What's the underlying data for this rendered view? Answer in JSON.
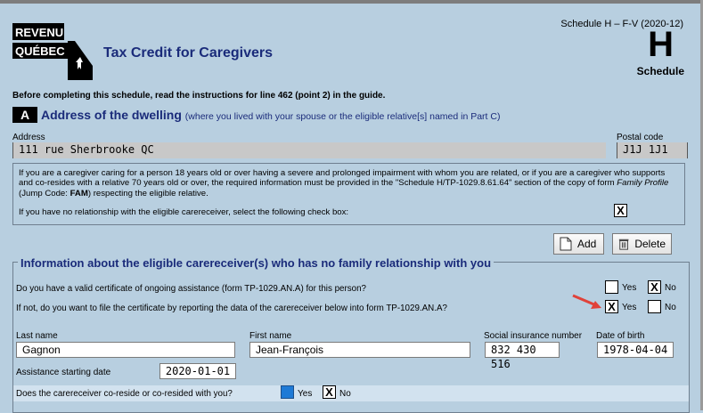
{
  "header": {
    "logo_line1": "REVENU",
    "logo_line2": "QUÉBEC",
    "title": "Tax Credit for Caregivers",
    "schedule_ref": "Schedule H – F-V (2020-12)",
    "schedule_letter": "H",
    "schedule_word": "Schedule"
  },
  "instructions": "Before completing this schedule, read the instructions for line 462 (point 2) in the guide.",
  "section_a": {
    "badge": "A",
    "title": "Address of the dwelling",
    "subtitle": "(where you lived with your spouse or the eligible relative[s] named in Part C)",
    "address_label": "Address",
    "address_value": "111 rue Sherbrooke QC",
    "postal_label": "Postal code",
    "postal_value": "J1J 1J1"
  },
  "info_box": {
    "para_part1": "If you are a caregiver caring for a person 18 years old or over having a severe and prolonged impairment with whom you are related, or if you are a caregiver who supports and co-resides with a relative 70 years old or over, the required information must be provided in the \"Schedule H/TP-1029.8.61.64\" section of the copy of form ",
    "para_italic": "Family Profile",
    "para_part2": " (Jump Code: ",
    "para_bold": "FAM",
    "para_part3": ") respecting the eligible relative.",
    "no_relationship_text": "If you have no relationship with the eligible carereceiver, select the following check box:",
    "no_relationship_checked": "X"
  },
  "buttons": {
    "add": "Add",
    "delete": "Delete"
  },
  "carereceiver": {
    "legend": "Information about the eligible carereceiver(s) who has no family relationship with you",
    "q1": "Do you have a valid certificate of ongoing assistance (form TP-1029.AN.A) for this person?",
    "q1_yes_label": "Yes",
    "q1_no_label": "No",
    "q1_yes_mark": "",
    "q1_no_mark": "X",
    "q2": "If not, do you want to file the certificate by reporting the data of the carereceiver below into form TP-1029.AN.A?",
    "q2_yes_label": "Yes",
    "q2_no_label": "No",
    "q2_yes_mark": "X",
    "q2_no_mark": "",
    "last_name_label": "Last name",
    "last_name": "Gagnon",
    "first_name_label": "First name",
    "first_name": "Jean-François",
    "sin_label": "Social insurance number",
    "sin": "832 430 516",
    "dob_label": "Date of birth",
    "dob": "1978-04-04",
    "assist_label": "Assistance starting date",
    "assist_date": "2020-01-01",
    "q3": "Does the carereceiver co-reside or co-resided with you?",
    "q3_yes_label": "Yes",
    "q3_no_label": "No",
    "q3_no_mark": "X"
  },
  "colors": {
    "background": "#b8cfe0",
    "title_blue": "#1a2b7a",
    "arrow_red": "#e0423a",
    "checkbox_selected": "#1e7ad6"
  }
}
